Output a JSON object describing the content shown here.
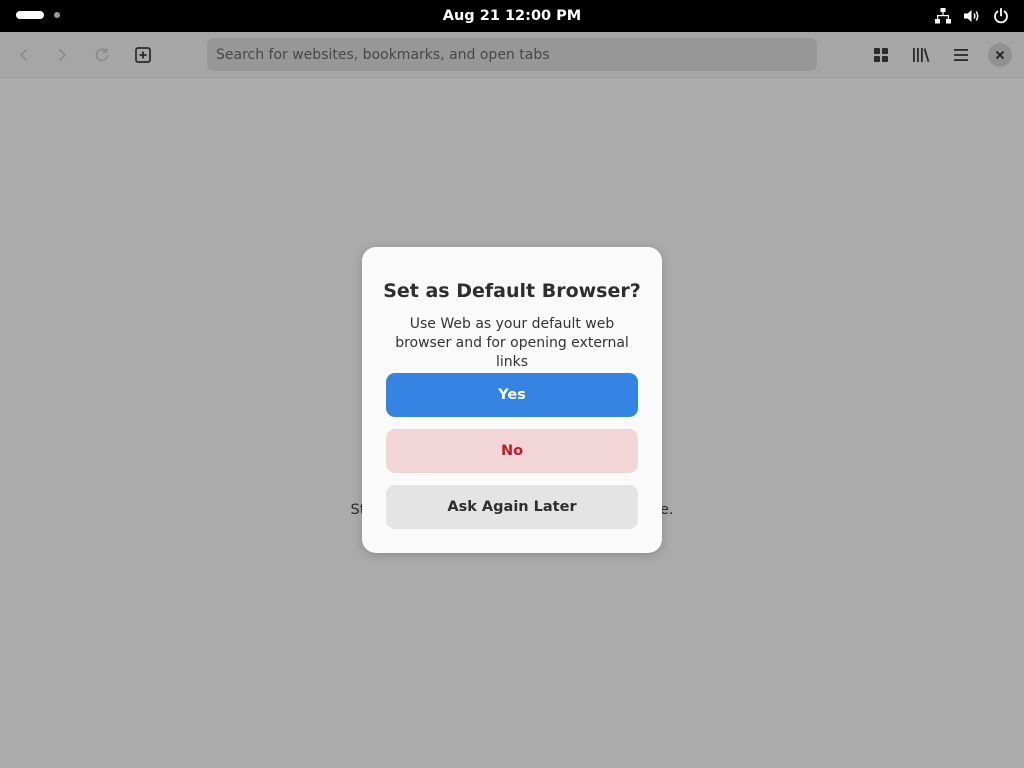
{
  "topbar": {
    "clock": "Aug 21  12:00 PM"
  },
  "toolbar": {
    "search_placeholder": "Search for websites, bookmarks, and open tabs"
  },
  "content": {
    "empty_text": "Start b                                                 r here."
  },
  "dialog": {
    "title": "Set as Default Browser?",
    "body": "Use Web as your default web browser and for opening external links",
    "yes_label": "Yes",
    "no_label": "No",
    "later_label": "Ask Again Later"
  },
  "colors": {
    "accent": "#3584e4",
    "destructive": "#c01c28",
    "destructive_bg": "#f2d6d7"
  },
  "icons": [
    "back-icon",
    "forward-icon",
    "reload-icon",
    "new-tab-icon",
    "tab-overview-icon",
    "library-icon",
    "menu-icon",
    "close-icon",
    "network-icon",
    "volume-icon",
    "power-icon"
  ]
}
